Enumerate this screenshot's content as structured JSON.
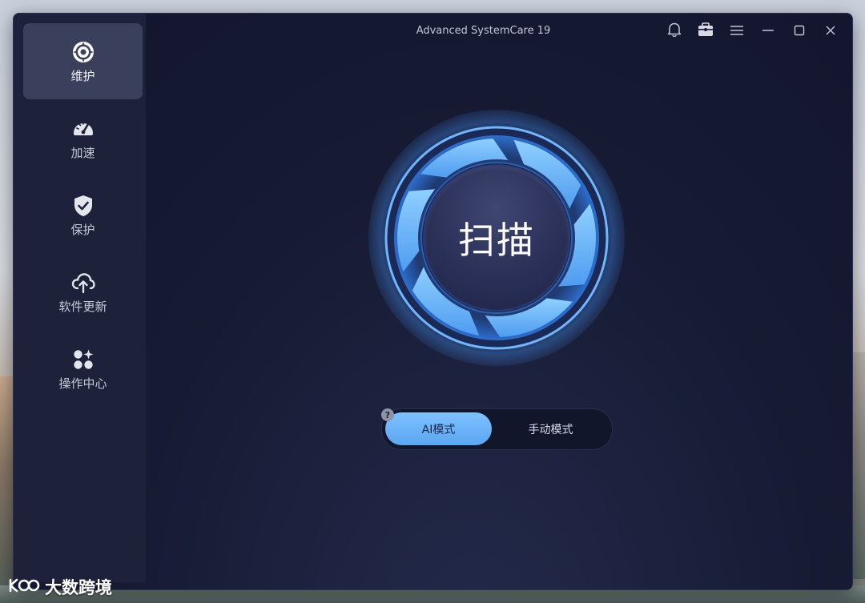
{
  "window": {
    "title": "Advanced SystemCare 19"
  },
  "titlebar_icons": [
    "bell-icon",
    "gift-box-icon",
    "menu-icon",
    "minimize-icon",
    "maximize-icon",
    "close-icon"
  ],
  "sidebar": {
    "items": [
      {
        "label": "维护",
        "icon": "maintenance-icon",
        "active": true
      },
      {
        "label": "加速",
        "icon": "speedometer-icon",
        "active": false
      },
      {
        "label": "保护",
        "icon": "shield-check-icon",
        "active": false
      },
      {
        "label": "软件更新",
        "icon": "cloud-upload-icon",
        "active": false
      },
      {
        "label": "操作中心",
        "icon": "action-center-icon",
        "active": false
      }
    ]
  },
  "main": {
    "scan_button_label": "扫描",
    "mode_toggle": {
      "help": "?",
      "options": [
        "AI模式",
        "手动模式"
      ],
      "selected": "AI模式"
    }
  },
  "watermark": {
    "text": "大数跨境"
  },
  "colors": {
    "accent": "#5aa6f2",
    "window_bg": "#161a33",
    "sidebar_bg": "#1d2139"
  }
}
